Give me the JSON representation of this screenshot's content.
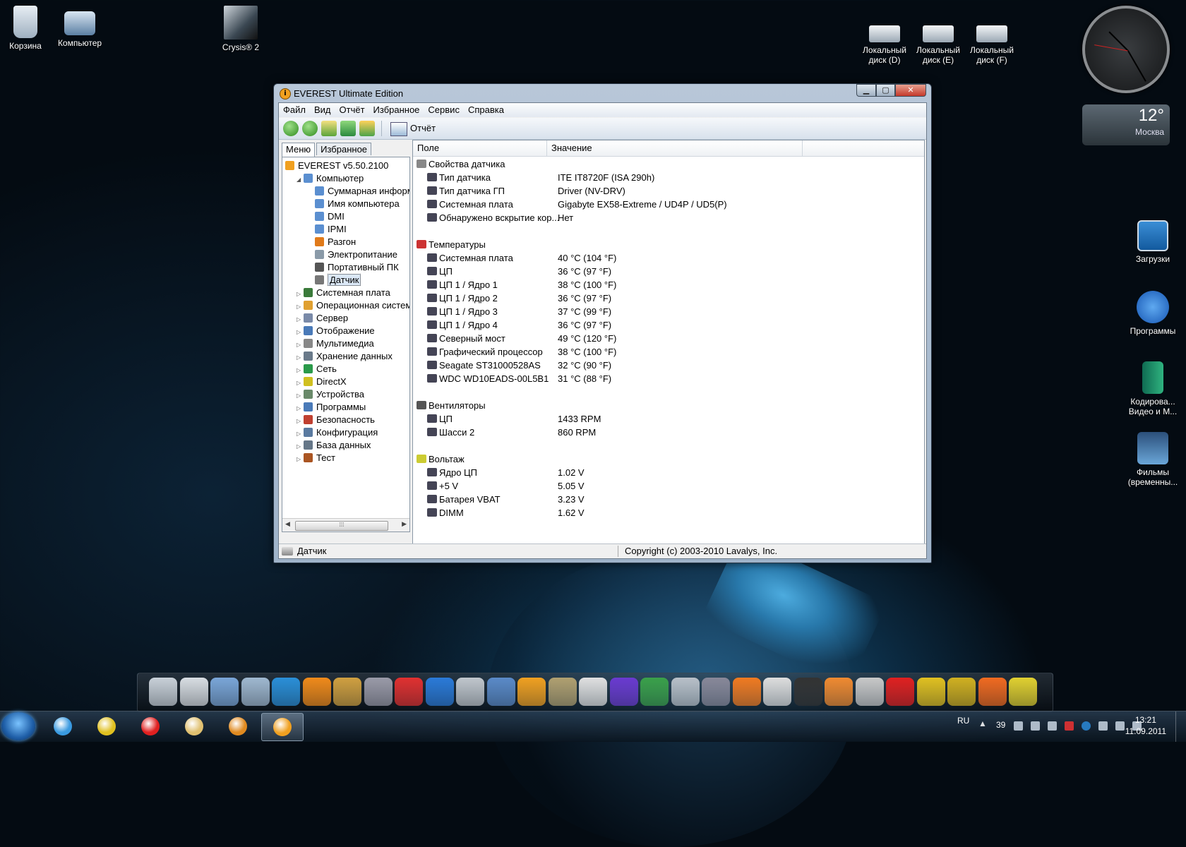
{
  "desktop": {
    "icons_left": [
      {
        "label": "Корзина",
        "icon": "recycle-bin-icon"
      },
      {
        "label": "Компьютер",
        "icon": "computer-icon"
      },
      {
        "label": "Crysis® 2",
        "icon": "crysis2-icon"
      }
    ],
    "drives": [
      {
        "line1": "Локальный",
        "line2": "диск (D)"
      },
      {
        "line1": "Локальный",
        "line2": "диск (E)"
      },
      {
        "line1": "Локальный",
        "line2": "диск (F)"
      }
    ],
    "icons_right": [
      {
        "line1": "Загрузки",
        "line2": ""
      },
      {
        "line1": "Программы",
        "line2": ""
      },
      {
        "line1": "Кодирова...",
        "line2": "Видео и М..."
      },
      {
        "line1": "Фильмы",
        "line2": "(временны..."
      }
    ]
  },
  "weather": {
    "temp": "12°",
    "city": "Москва"
  },
  "window": {
    "title": "EVEREST Ultimate Edition",
    "controls": {
      "min": "▁",
      "max": "▢",
      "close": "✕"
    },
    "menu": [
      "Файл",
      "Вид",
      "Отчёт",
      "Избранное",
      "Сервис",
      "Справка"
    ],
    "toolbar": {
      "report_label": "Отчёт"
    },
    "tabs": {
      "menu": "Меню",
      "favorites": "Избранное"
    },
    "tree": [
      {
        "label": "EVEREST v5.50.2100",
        "level": 0,
        "expander": "",
        "color": "#f0a020"
      },
      {
        "label": "Компьютер",
        "level": 1,
        "expander": "◢",
        "color": "#5b8fd0"
      },
      {
        "label": "Суммарная информа",
        "level": 2,
        "expander": "",
        "color": "#5b8fd0"
      },
      {
        "label": "Имя компьютера",
        "level": 2,
        "expander": "",
        "color": "#5b8fd0"
      },
      {
        "label": "DMI",
        "level": 2,
        "expander": "",
        "color": "#5b8fd0"
      },
      {
        "label": "IPMI",
        "level": 2,
        "expander": "",
        "color": "#5b8fd0"
      },
      {
        "label": "Разгон",
        "level": 2,
        "expander": "",
        "color": "#e07a1a"
      },
      {
        "label": "Электропитание",
        "level": 2,
        "expander": "",
        "color": "#8a9aa8"
      },
      {
        "label": "Портативный ПК",
        "level": 2,
        "expander": "",
        "color": "#555555"
      },
      {
        "label": "Датчик",
        "level": 2,
        "expander": "",
        "color": "#777777",
        "selected": true
      },
      {
        "label": "Системная плата",
        "level": 1,
        "expander": "▷",
        "color": "#3a7a3a"
      },
      {
        "label": "Операционная система",
        "level": 1,
        "expander": "▷",
        "color": "#e0a030"
      },
      {
        "label": "Сервер",
        "level": 1,
        "expander": "▷",
        "color": "#7a8aa8"
      },
      {
        "label": "Отображение",
        "level": 1,
        "expander": "▷",
        "color": "#4a7ab8"
      },
      {
        "label": "Мультимедиа",
        "level": 1,
        "expander": "▷",
        "color": "#888888"
      },
      {
        "label": "Хранение данных",
        "level": 1,
        "expander": "▷",
        "color": "#6a7a8a"
      },
      {
        "label": "Сеть",
        "level": 1,
        "expander": "▷",
        "color": "#2a9a4a"
      },
      {
        "label": "DirectX",
        "level": 1,
        "expander": "▷",
        "color": "#d0c020"
      },
      {
        "label": "Устройства",
        "level": 1,
        "expander": "▷",
        "color": "#6a8a6a"
      },
      {
        "label": "Программы",
        "level": 1,
        "expander": "▷",
        "color": "#4a7ab8"
      },
      {
        "label": "Безопасность",
        "level": 1,
        "expander": "▷",
        "color": "#c04030"
      },
      {
        "label": "Конфигурация",
        "level": 1,
        "expander": "▷",
        "color": "#5a7aa0"
      },
      {
        "label": "База данных",
        "level": 1,
        "expander": "▷",
        "color": "#667788"
      },
      {
        "label": "Тест",
        "level": 1,
        "expander": "▷",
        "color": "#aa5522"
      }
    ],
    "columns": {
      "field": "Поле",
      "value": "Значение"
    },
    "sections": [
      {
        "title": "Свойства датчика",
        "rows": [
          {
            "field": "Тип датчика",
            "value": "ITE IT8720F  (ISA 290h)"
          },
          {
            "field": "Тип датчика ГП",
            "value": "Driver  (NV-DRV)"
          },
          {
            "field": "Системная плата",
            "value": "Gigabyte EX58-Extreme / UD4P / UD5(P)"
          },
          {
            "field": "Обнаружено вскрытие кор...",
            "value": "Нет"
          }
        ]
      },
      {
        "title": "Температуры",
        "rows": [
          {
            "field": "Системная плата",
            "value": "40 °C  (104 °F)"
          },
          {
            "field": "ЦП",
            "value": "36 °C  (97 °F)"
          },
          {
            "field": "ЦП 1 / Ядро 1",
            "value": "38 °C  (100 °F)"
          },
          {
            "field": "ЦП 1 / Ядро 2",
            "value": "36 °C  (97 °F)"
          },
          {
            "field": "ЦП 1 / Ядро 3",
            "value": "37 °C  (99 °F)"
          },
          {
            "field": "ЦП 1 / Ядро 4",
            "value": "36 °C  (97 °F)"
          },
          {
            "field": "Северный мост",
            "value": "49 °C  (120 °F)"
          },
          {
            "field": "Графический процессор",
            "value": "38 °C  (100 °F)"
          },
          {
            "field": "Seagate ST31000528AS",
            "value": "32 °C  (90 °F)"
          },
          {
            "field": "WDC WD10EADS-00L5B1",
            "value": "31 °C  (88 °F)"
          }
        ]
      },
      {
        "title": "Вентиляторы",
        "rows": [
          {
            "field": "ЦП",
            "value": "1433 RPM"
          },
          {
            "field": "Шасси 2",
            "value": "860 RPM"
          }
        ]
      },
      {
        "title": "Вольтаж",
        "rows": [
          {
            "field": "Ядро ЦП",
            "value": "1.02 V"
          },
          {
            "field": "+5 V",
            "value": "5.05 V"
          },
          {
            "field": "Батарея VBAT",
            "value": "3.23 V"
          },
          {
            "field": "DIMM",
            "value": "1.62 V"
          }
        ]
      }
    ],
    "status": {
      "left": "Датчик",
      "right": "Copyright (c) 2003-2010 Lavalys, Inc."
    }
  },
  "dock_colors": [
    "#c8d0d8",
    "#d8dde2",
    "#7aa6d8",
    "#9fb8d0",
    "#2a8fd8",
    "#f08a1a",
    "#d0a040",
    "#9a9aa8",
    "#e03030",
    "#2a7ad8",
    "#c0c6cc",
    "#5a8ac8",
    "#f0a020",
    "#b0a070",
    "#e0e0e0",
    "#6a3ad0",
    "#3aa04a",
    "#b8c0c8",
    "#888899",
    "#f07a20",
    "#dddddd",
    "#333333",
    "#f08a30",
    "#c8c8c8",
    "#e02020",
    "#e0c020",
    "#d0b020",
    "#f06a20",
    "#e0d030"
  ],
  "taskbar": {
    "lang": "RU",
    "num": "39",
    "time": "13:21",
    "date": "11.09.2011",
    "apps": [
      {
        "name": "ie",
        "color": "#3a9ae0"
      },
      {
        "name": "chrome",
        "color": "#e0c020"
      },
      {
        "name": "opera",
        "color": "#e02020"
      },
      {
        "name": "explorer",
        "color": "#e0c070"
      },
      {
        "name": "media",
        "color": "#e08a20"
      },
      {
        "name": "everest",
        "color": "#f0a020"
      }
    ]
  }
}
